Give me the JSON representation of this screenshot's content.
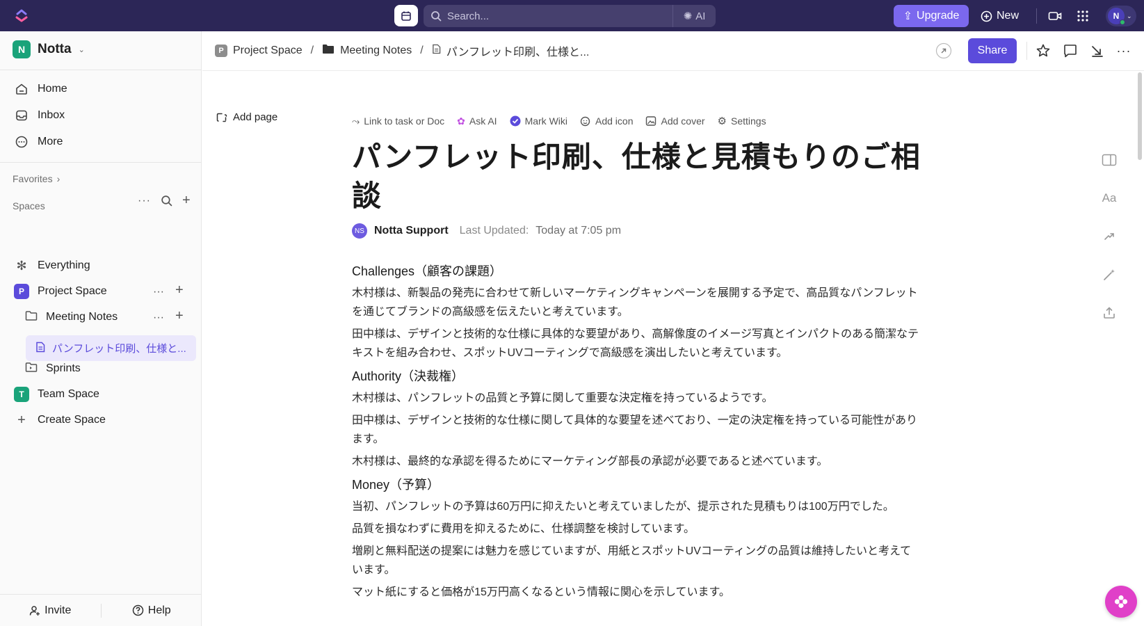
{
  "topbar": {
    "search_placeholder": "Search...",
    "ai_label": "AI",
    "upgrade_label": "Upgrade",
    "new_label": "New",
    "avatar_initial": "N"
  },
  "sidebar": {
    "workspace_name": "Notta",
    "workspace_initial": "N",
    "nav": [
      {
        "label": "Home",
        "icon": "home-icon"
      },
      {
        "label": "Inbox",
        "icon": "inbox-icon"
      },
      {
        "label": "More",
        "icon": "more-icon"
      }
    ],
    "favorites_label": "Favorites",
    "spaces_label": "Spaces",
    "everything_label": "Everything",
    "project_space": {
      "label": "Project Space",
      "initial": "P",
      "color": "#5b4bdb"
    },
    "meeting_notes_label": "Meeting Notes",
    "active_doc_label": "パンフレット印刷、仕様と...",
    "sprints_label": "Sprints",
    "team_space": {
      "label": "Team Space",
      "initial": "T",
      "color": "#1aa37a"
    },
    "create_space_label": "Create Space",
    "invite_label": "Invite",
    "help_label": "Help"
  },
  "header": {
    "crumb_project": "Project Space",
    "crumb_project_initial": "P",
    "crumb_folder": "Meeting Notes",
    "crumb_doc": "パンフレット印刷、仕様と...",
    "share_label": "Share"
  },
  "doc": {
    "add_page_label": "Add page",
    "actions": {
      "link": "Link to task or Doc",
      "ask_ai": "Ask AI",
      "mark_wiki": "Mark Wiki",
      "add_icon": "Add icon",
      "add_cover": "Add cover",
      "settings": "Settings"
    },
    "title": "パンフレット印刷、仕様と見積もりのご相談",
    "author_initials": "NS",
    "author": "Notta Support",
    "last_updated_label": "Last Updated:",
    "last_updated_value": "Today at 7:05 pm",
    "h_challenges": "Challenges（顧客の課題）",
    "p1": "木村様は、新製品の発売に合わせて新しいマーケティングキャンペーンを展開する予定で、高品質なパンフレットを通じてブランドの高級感を伝えたいと考えています。",
    "p2": "田中様は、デザインと技術的な仕様に具体的な要望があり、高解像度のイメージ写真とインパクトのある簡潔なテキストを組み合わせ、スポットUVコーティングで高級感を演出したいと考えています。",
    "h_authority": "Authority（決裁権）",
    "p3": "木村様は、パンフレットの品質と予算に関して重要な決定権を持っているようです。",
    "p4": "田中様は、デザインと技術的な仕様に関して具体的な要望を述べており、一定の決定権を持っている可能性があります。",
    "p5": "木村様は、最終的な承認を得るためにマーケティング部長の承認が必要であると述べています。",
    "h_money": "Money（予算）",
    "p6": "当初、パンフレットの予算は60万円に抑えたいと考えていましたが、提示された見積もりは100万円でした。",
    "p7": "品質を損なわずに費用を抑えるために、仕様調整を検討しています。",
    "p8": "増刷と無料配送の提案には魅力を感じていますが、用紙とスポットUVコーティングの品質は維持したいと考えています。",
    "p9": "マット紙にすると価格が15万円高くなるという情報に関心を示しています。"
  },
  "colors": {
    "topbar": "#2c2657",
    "accent": "#5b4bdb",
    "upgrade": "#7b68ee",
    "fab": "#e040c8"
  }
}
